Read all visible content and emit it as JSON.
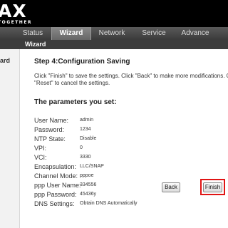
{
  "brand": {
    "logo": "AX",
    "tagline": "TOGETHER"
  },
  "nav": {
    "items": [
      {
        "label": "Status"
      },
      {
        "label": "Wizard"
      },
      {
        "label": "Network"
      },
      {
        "label": "Service"
      },
      {
        "label": "Advance"
      }
    ],
    "active": "Wizard"
  },
  "subnav": {
    "label": "Wizard"
  },
  "sidebar": {
    "item": "ard"
  },
  "main": {
    "step_title": "Step 4:Configuration Saving",
    "description_line1": "Click \"Finish\" to save the settings. Click \"Back\" to make more modifications. C",
    "description_line2": "\"Reset\" to cancel the settings.",
    "params_title": "The parameters you set:",
    "params": [
      {
        "label": "User Name:",
        "value": "admin"
      },
      {
        "label": "Password:",
        "value": "1234"
      },
      {
        "label": "NTP State:",
        "value": "Disable"
      },
      {
        "label": "VPI:",
        "value": "0"
      },
      {
        "label": "VCI:",
        "value": "3330"
      },
      {
        "label": "Encapsulation:",
        "value": "LLC/SNAP"
      },
      {
        "label": "Channel Mode:",
        "value": "pppoe"
      },
      {
        "label": "ppp User Name:",
        "value": "334556"
      },
      {
        "label": "ppp Password:",
        "value": "45436y"
      },
      {
        "label": "DNS Settings:",
        "value": "Obtain DNS Automatically"
      }
    ]
  },
  "buttons": {
    "back": "Back",
    "finish": "Finish"
  },
  "colors": {
    "highlight": "#e01414",
    "topbar": "#000000",
    "navbar": "#4a4a4a"
  }
}
